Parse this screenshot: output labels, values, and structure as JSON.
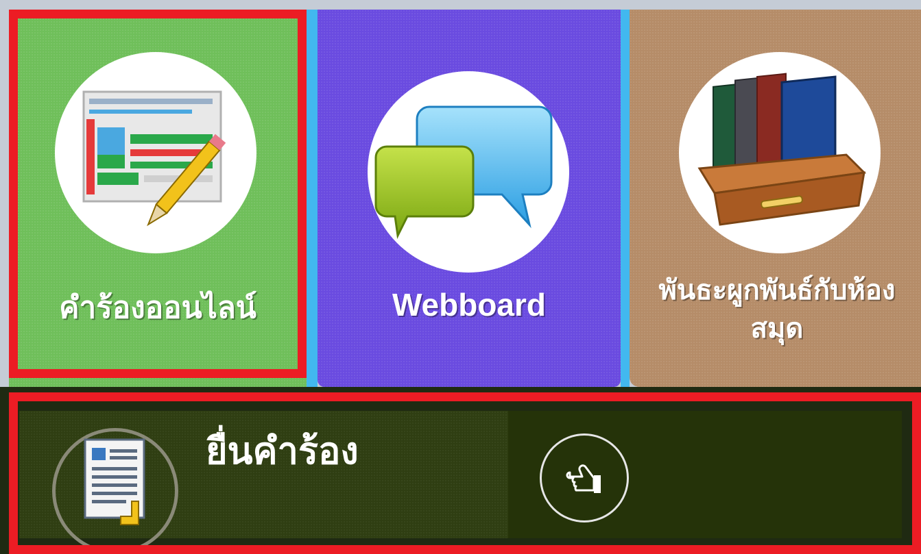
{
  "tiles": [
    {
      "label": "คำร้องออนไลน์",
      "icon": "online-request-form-icon",
      "color": "#6fbf5a",
      "highlighted": true
    },
    {
      "label": "Webboard",
      "icon": "chat-bubbles-icon",
      "color": "#6a4be0",
      "highlighted": false
    },
    {
      "label": "พันธะผูกพันธ์กับห้องสมุด",
      "icon": "books-drawer-icon",
      "color": "#b58c68",
      "highlighted": false
    }
  ],
  "action_panel": {
    "title": "ยื่นคำร้อง",
    "icon": "document-pointer-icon",
    "go_icon": "pointing-hand-icon",
    "highlighted": true
  },
  "colors": {
    "highlight": "#ec1c24",
    "separator": "#42b8ef",
    "panel_bg": "#2f3e12"
  }
}
